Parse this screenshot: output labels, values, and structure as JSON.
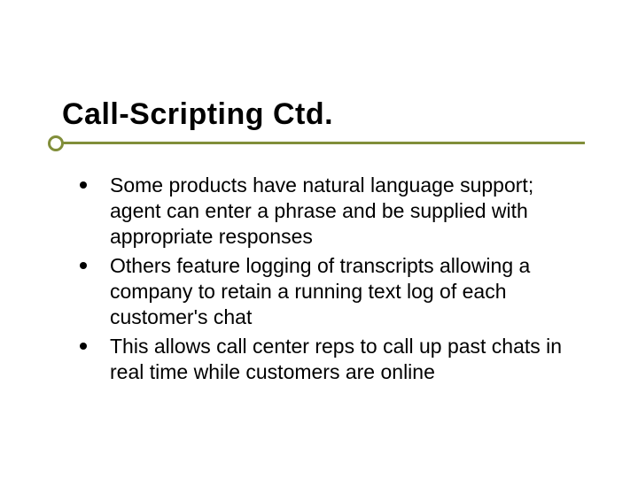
{
  "slide": {
    "title": "Call-Scripting Ctd.",
    "accent_color": "#818e3a",
    "bullets": [
      "Some products have natural language support; agent can enter a phrase and be supplied with appropriate responses",
      "Others feature logging of transcripts allowing a company to retain a running text log of each customer's chat",
      "This allows call center reps to call up past chats in real time while customers are online"
    ]
  }
}
